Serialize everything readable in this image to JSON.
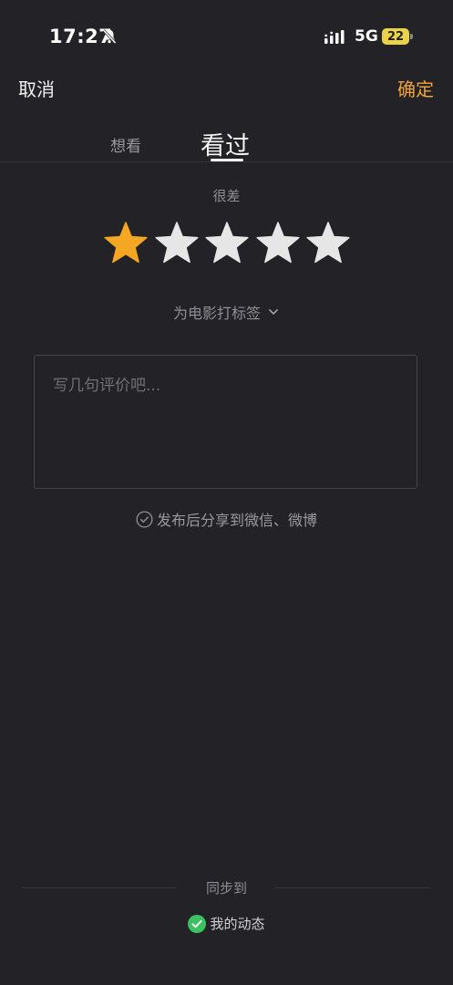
{
  "status_bar": {
    "time": "17:27",
    "network": "5G",
    "battery": "22"
  },
  "header": {
    "cancel_label": "取消",
    "confirm_label": "确定"
  },
  "tabs": [
    {
      "label": "想看",
      "selected": false
    },
    {
      "label": "看过",
      "selected": true
    }
  ],
  "rating": {
    "text": "很差",
    "value": 1,
    "max": 5,
    "filled_color": "#f5a623",
    "empty_color": "#e6e6e6"
  },
  "tag_link": {
    "label": "为电影打标签"
  },
  "review": {
    "placeholder": "写几句评价吧...",
    "value": ""
  },
  "share": {
    "label": "发布后分享到微信、微博"
  },
  "sync": {
    "title": "同步到",
    "item_label": "我的动态",
    "check_color": "#3cc161"
  }
}
